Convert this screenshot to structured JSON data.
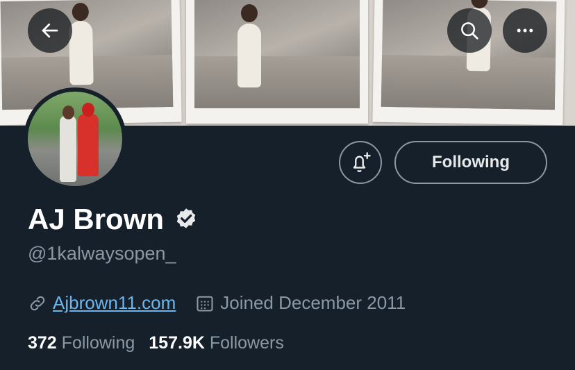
{
  "banner": {
    "back_icon": "arrow-left-icon",
    "search_icon": "search-icon",
    "more_icon": "more-horizontal-icon"
  },
  "profile": {
    "name": "AJ Brown",
    "verified_icon": "verified-badge-icon",
    "handle": "@1kalwaysopen_",
    "website": "Ajbrown11.com",
    "joined": "Joined December 2011",
    "following_count": "372",
    "following_label": "Following",
    "followers_count": "157.9K",
    "followers_label": "Followers"
  },
  "actions": {
    "notify_icon": "bell-plus-icon",
    "follow_state": "Following"
  },
  "colors": {
    "background": "#15202b",
    "link": "#6cb6ef",
    "muted": "#8b98a5"
  }
}
